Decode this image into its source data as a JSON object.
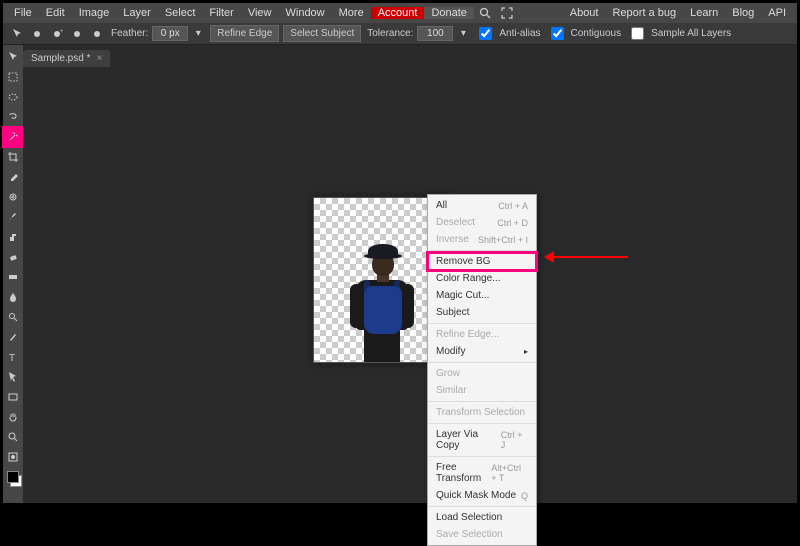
{
  "menubar": {
    "items": [
      "File",
      "Edit",
      "Image",
      "Layer",
      "Select",
      "Filter",
      "View",
      "Window",
      "More"
    ],
    "account": "Account",
    "donate": "Donate",
    "right": [
      "About",
      "Report a bug",
      "Learn",
      "Blog",
      "API"
    ]
  },
  "optbar": {
    "feather_label": "Feather:",
    "feather_value": "0 px",
    "refine": "Refine Edge",
    "select_subject": "Select Subject",
    "tolerance_label": "Tolerance:",
    "tolerance_value": "100",
    "antialias": "Anti-alias",
    "contiguous": "Contiguous",
    "sample_all": "Sample All Layers"
  },
  "tab": {
    "title": "Sample.psd *"
  },
  "tools": [
    "move",
    "rect-select",
    "ellipse-select",
    "lasso",
    "magic-wand",
    "crop",
    "eyedropper",
    "spot-heal",
    "brush",
    "clone",
    "eraser",
    "gradient",
    "blur",
    "dodge",
    "pen",
    "text",
    "path-select",
    "rectangle",
    "hand",
    "zoom",
    "quick-mask"
  ],
  "tool_selected_index": 4,
  "contextmenu": {
    "items": [
      {
        "label": "All",
        "shortcut": "Ctrl + A",
        "disabled": false
      },
      {
        "label": "Deselect",
        "shortcut": "Ctrl + D",
        "disabled": true
      },
      {
        "label": "Inverse",
        "shortcut": "Shift+Ctrl + I",
        "disabled": true
      },
      {
        "sep": true
      },
      {
        "label": "Remove BG",
        "highlight": true
      },
      {
        "label": "Color Range..."
      },
      {
        "label": "Magic Cut..."
      },
      {
        "label": "Subject"
      },
      {
        "sep": true
      },
      {
        "label": "Refine Edge...",
        "disabled": true
      },
      {
        "label": "Modify",
        "submenu": true
      },
      {
        "sep": true
      },
      {
        "label": "Grow",
        "disabled": true
      },
      {
        "label": "Similar",
        "disabled": true
      },
      {
        "sep": true
      },
      {
        "label": "Transform Selection",
        "disabled": true
      },
      {
        "sep": true
      },
      {
        "label": "Layer Via Copy",
        "shortcut": "Ctrl + J"
      },
      {
        "sep": true
      },
      {
        "label": "Free Transform",
        "shortcut": "Alt+Ctrl + T"
      },
      {
        "label": "Quick Mask Mode",
        "shortcut": "Q"
      },
      {
        "sep": true
      },
      {
        "label": "Load Selection"
      },
      {
        "label": "Save Selection",
        "disabled": true
      }
    ]
  }
}
